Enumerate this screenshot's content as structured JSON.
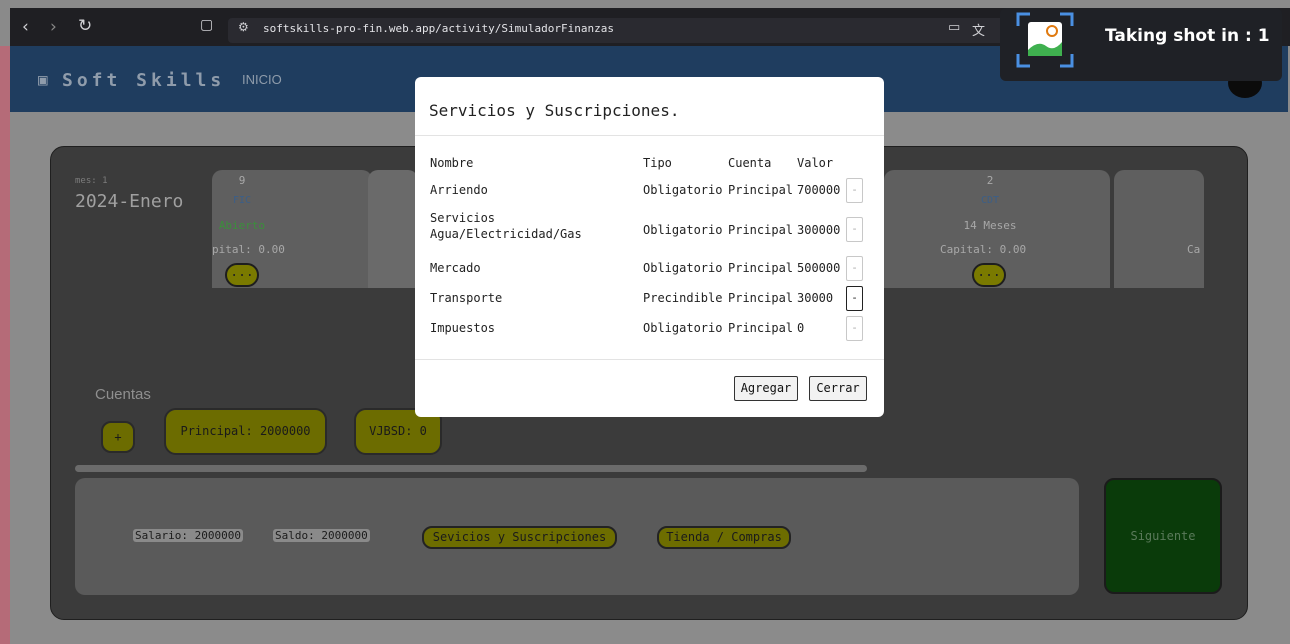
{
  "browser": {
    "back_icon": "chevron-left-icon",
    "forward_icon": "chevron-right-icon",
    "reload_icon": "reload-icon",
    "bookmark_icon": "bookmark-icon",
    "site_icon": "site-settings-icon",
    "url": "softskills-pro-fin.web.app/activity/SimuladorFinanzas",
    "cast_icon": "cast-icon",
    "translate_icon": "translate-icon"
  },
  "toast": {
    "text": "Taking shot in : 1",
    "icon": "image-capture-icon"
  },
  "navbar": {
    "brand": "Soft Skills",
    "brand_icon": "robot-icon",
    "inicio": "INICIO"
  },
  "month": {
    "mes_label": "mes: 1",
    "fecha": "2024-Enero"
  },
  "cards": [
    {
      "num": "9",
      "type": "FIC",
      "status": "Abierto",
      "capital": "pital: 0.00",
      "more": "..."
    },
    {
      "num": "2",
      "type": "CDT",
      "term": "14 Meses",
      "capital": "Capital: 0.00",
      "more": "..."
    }
  ],
  "card_edge_text": "Ca",
  "cuentas": {
    "title": "Cuentas",
    "add": "+",
    "accounts": [
      "Principal: 2000000",
      "VJBSD: 0"
    ]
  },
  "bottom": {
    "salario": "Salario: 2000000",
    "saldo": "Saldo: 2000000",
    "servicios_btn": "Sevicios y Suscripciones",
    "tienda_btn": "Tienda / Compras",
    "siguiente": "Siguiente"
  },
  "modal": {
    "title": "Servicios y Suscripciones.",
    "headers": {
      "nombre": "Nombre",
      "tipo": "Tipo",
      "cuenta": "Cuenta",
      "valor": "Valor"
    },
    "rows": [
      {
        "nombre": "Arriendo",
        "tipo": "Obligatorio",
        "cuenta": "Principal",
        "valor": "700000",
        "del": "-"
      },
      {
        "nombre": "Servicios Agua/Electricidad/Gas",
        "tipo": "Obligatorio",
        "cuenta": "Principal",
        "valor": "300000",
        "del": "-"
      },
      {
        "nombre": "Mercado",
        "tipo": "Obligatorio",
        "cuenta": "Principal",
        "valor": "500000",
        "del": "-"
      },
      {
        "nombre": "Transporte",
        "tipo": "Precindible",
        "cuenta": "Principal",
        "valor": "30000",
        "del": "-"
      },
      {
        "nombre": "Impuestos",
        "tipo": "Obligatorio",
        "cuenta": "Principal",
        "valor": "0",
        "del": "-"
      }
    ],
    "agregar": "Agregar",
    "cerrar": "Cerrar"
  },
  "colors": {
    "navbar": "#1f3d5f",
    "board": "#3b3b3b",
    "accent_yellow": "#6d6d00",
    "siguiente_green": "#0a3b0a",
    "modal_bg": "#ffffff"
  }
}
